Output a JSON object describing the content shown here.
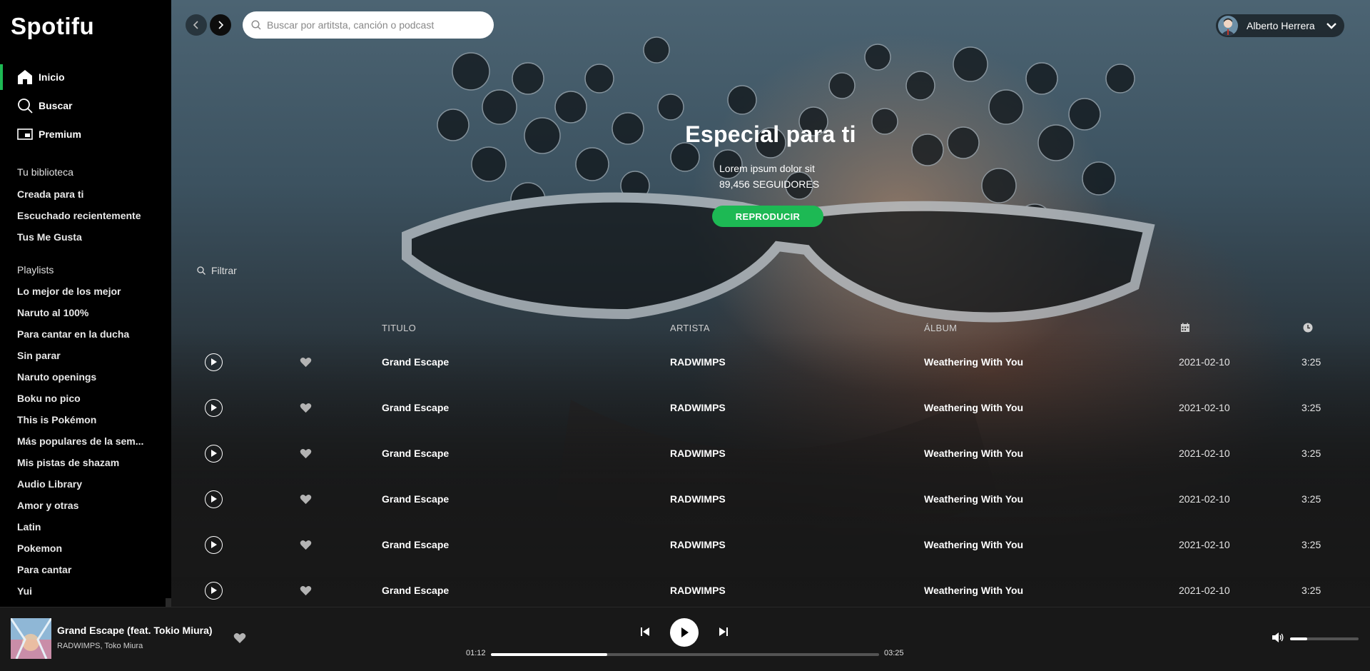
{
  "app": {
    "logo": "Spotifu"
  },
  "sidebar": {
    "nav": [
      {
        "label": "Inicio",
        "icon": "home-icon",
        "active": true
      },
      {
        "label": "Buscar",
        "icon": "search-icon",
        "active": false
      },
      {
        "label": "Premium",
        "icon": "premium-icon",
        "active": false
      }
    ],
    "library_title": "Tu biblioteca",
    "library": [
      "Creada para ti",
      "Escuchado recientemente",
      "Tus Me Gusta"
    ],
    "playlists_title": "Playlists",
    "playlists": [
      "Lo mejor de los mejor",
      "Naruto al 100%",
      "Para cantar en la ducha",
      "Sin parar",
      "Naruto openings",
      "Boku no pico",
      "This is Pokémon",
      "Más populares de la sem...",
      "Mis pistas de shazam",
      "Audio Library",
      "Amor y otras",
      "Latin",
      "Pokemon",
      "Para cantar",
      "Yui"
    ]
  },
  "topbar": {
    "search_placeholder": "Buscar por artitsta, canción o podcast",
    "user_name": "Alberto Herrera"
  },
  "hero": {
    "title": "Especial para ti",
    "description": "Lorem ipsum dolor sit",
    "followers": "89,456 SEGUIDORES",
    "play_label": "REPRODUCIR"
  },
  "filter": {
    "placeholder": "Filtrar"
  },
  "table": {
    "headers": {
      "title": "TITULO",
      "artist": "ARTISTA",
      "album": "ÁLBUM",
      "date_icon": "calendar-icon",
      "duration_icon": "clock-icon"
    },
    "rows": [
      {
        "title": "Grand Escape",
        "artist": "RADWIMPS",
        "album": "Weathering With You",
        "date": "2021-02-10",
        "duration": "3:25"
      },
      {
        "title": "Grand Escape",
        "artist": "RADWIMPS",
        "album": "Weathering With You",
        "date": "2021-02-10",
        "duration": "3:25"
      },
      {
        "title": "Grand Escape",
        "artist": "RADWIMPS",
        "album": "Weathering With You",
        "date": "2021-02-10",
        "duration": "3:25"
      },
      {
        "title": "Grand Escape",
        "artist": "RADWIMPS",
        "album": "Weathering With You",
        "date": "2021-02-10",
        "duration": "3:25"
      },
      {
        "title": "Grand Escape",
        "artist": "RADWIMPS",
        "album": "Weathering With You",
        "date": "2021-02-10",
        "duration": "3:25"
      },
      {
        "title": "Grand Escape",
        "artist": "RADWIMPS",
        "album": "Weathering With You",
        "date": "2021-02-10",
        "duration": "3:25"
      }
    ]
  },
  "player": {
    "track_title": "Grand Escape (feat. Tokio Miura)",
    "track_artist": "RADWIMPS, Toko Miura",
    "current_time": "01:12",
    "total_time": "03:25",
    "progress": 0.3,
    "volume": 0.25
  },
  "colors": {
    "accent": "#1db954",
    "sidebar_bg": "#000000",
    "player_bg": "#181818"
  }
}
